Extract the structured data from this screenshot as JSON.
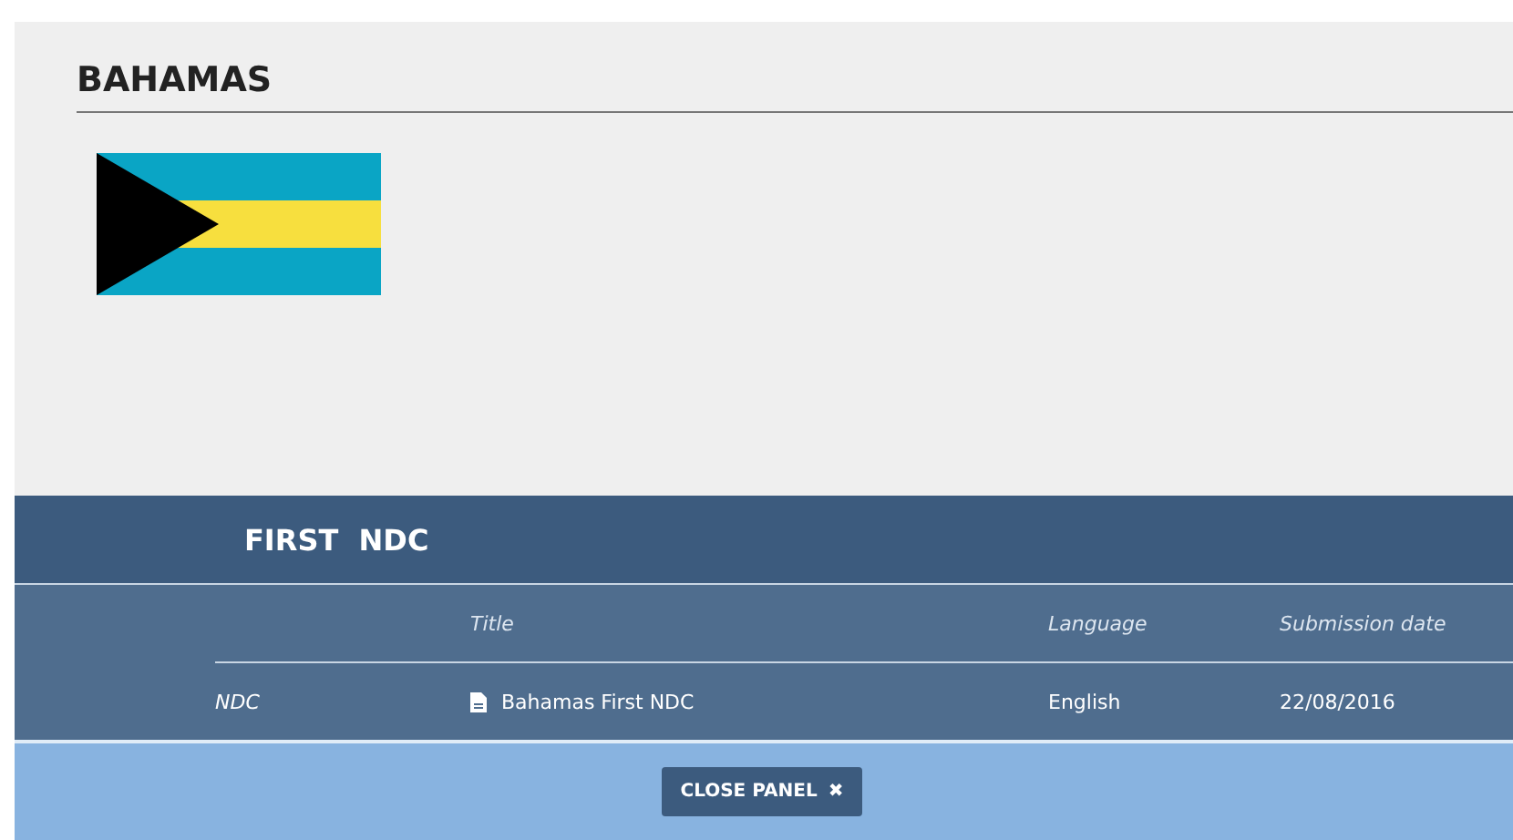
{
  "country": {
    "title": "BAHAMAS"
  },
  "section": {
    "title": "FIRST  NDC",
    "columns": [
      "Title",
      "Language",
      "Submission date"
    ],
    "rows": [
      {
        "type": "NDC",
        "title": "Bahamas First NDC",
        "language": "English",
        "date": "22/08/2016"
      }
    ]
  },
  "close_button": {
    "label": "CLOSE PANEL",
    "icon": "✖"
  }
}
